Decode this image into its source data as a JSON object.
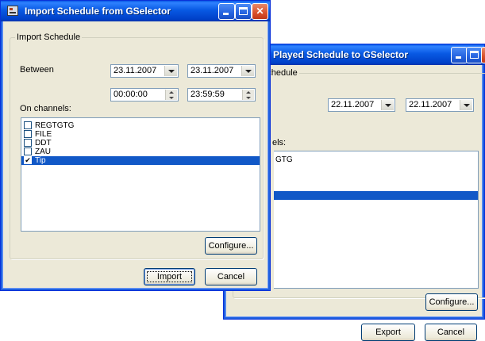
{
  "export_window": {
    "title": "Played Schedule to GSelector",
    "group_label": "ayed Schedule",
    "date_from": "22.11.2007",
    "date_to": "22.11.2007",
    "channels_label_partial": "els:",
    "channels_partial": [
      {
        "label": "GTG",
        "selected": false
      },
      {
        "label": "",
        "selected": true
      }
    ],
    "configure_button": "Configure...",
    "export_button": "Export",
    "cancel_button": "Cancel"
  },
  "import_window": {
    "title": "Import Schedule from GSelector",
    "group_label": "Import Schedule",
    "between_label": "Between",
    "date_from": "23.11.2007",
    "date_to": "23.11.2007",
    "time_from": "00:00:00",
    "time_to": "23:59:59",
    "channels_label": "On channels:",
    "channels": [
      {
        "label": "REGTGTG",
        "checked": false,
        "selected": false
      },
      {
        "label": "FILE",
        "checked": false,
        "selected": false
      },
      {
        "label": "DDT",
        "checked": false,
        "selected": false
      },
      {
        "label": "ZAU",
        "checked": false,
        "selected": false
      },
      {
        "label": "Tip",
        "checked": true,
        "selected": true
      }
    ],
    "configure_button": "Configure...",
    "import_button": "Import",
    "cancel_button": "Cancel",
    "check_glyph": "✔"
  },
  "colors": {
    "title_bar": "#0859e3",
    "selection": "#1158c7",
    "close_button": "#d94f2a",
    "dialog_face": "#ece9d8"
  },
  "icons": {
    "app": "calendar-app-icon",
    "minimize": "minimize-icon",
    "maximize": "maximize-icon",
    "close": "close-icon"
  }
}
